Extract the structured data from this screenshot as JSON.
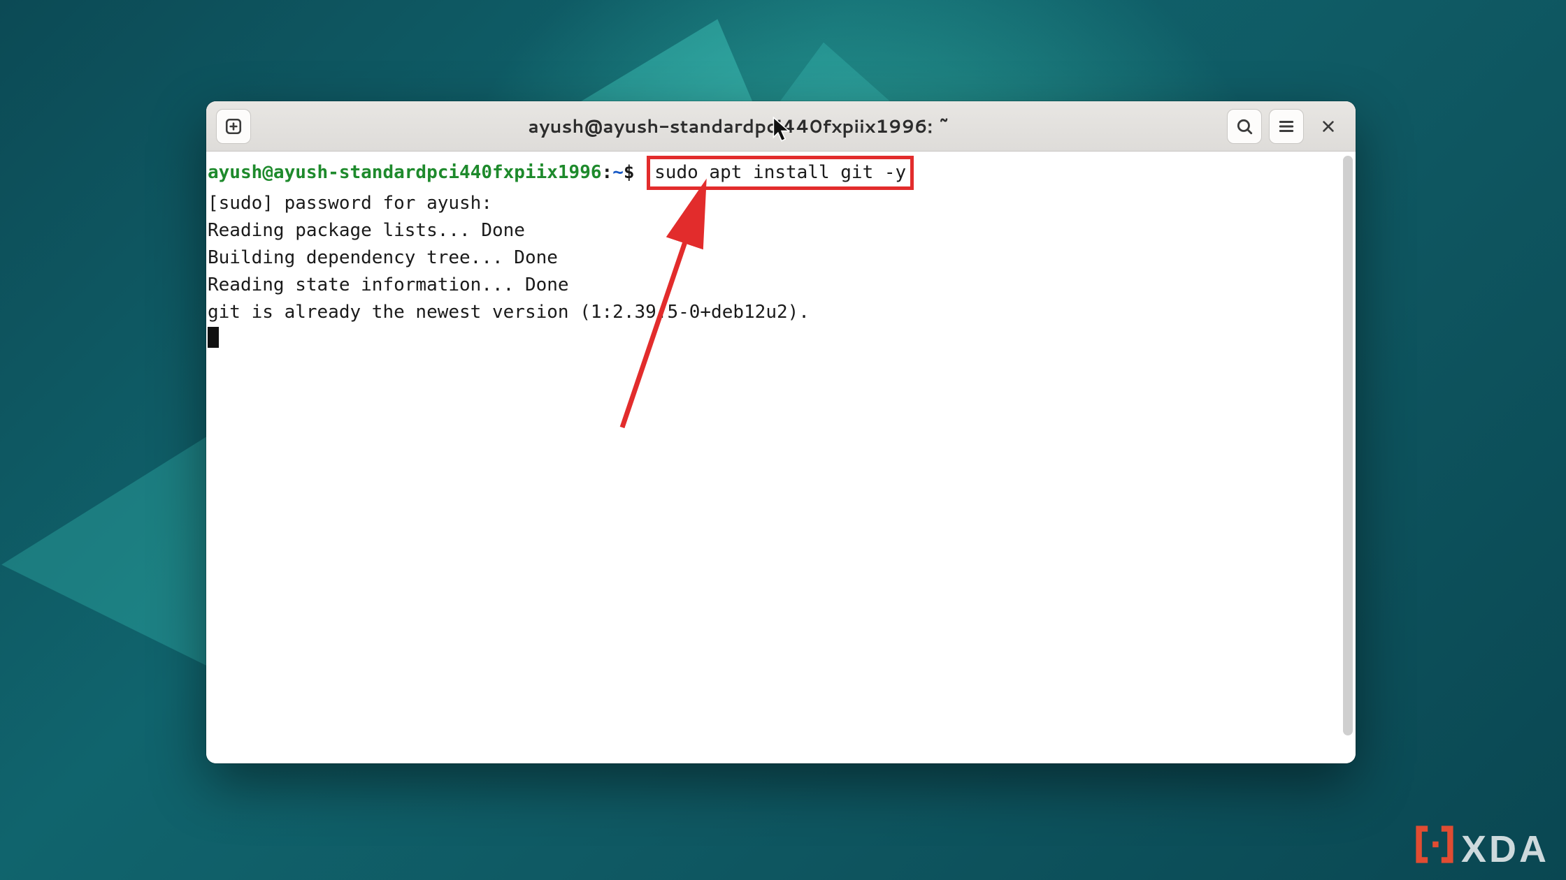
{
  "window": {
    "title": "ayush@ayush-standardpci440fxpiix1996: ~"
  },
  "toolbar": {
    "new_tab_button": "New tab",
    "search_button": "Search",
    "menu_button": "Menu",
    "close_button": "Close"
  },
  "prompt": {
    "user_host": "ayush@ayush-standardpci440fxpiix1996",
    "separator1": ":",
    "path": "~",
    "separator2": "$"
  },
  "command": "sudo apt install git -y",
  "output_lines": [
    "[sudo] password for ayush:",
    "Reading package lists... Done",
    "Building dependency tree... Done",
    "Reading state information... Done",
    "git is already the newest version (1:2.39.5-0+deb12u2)."
  ],
  "annotation": {
    "highlight_target": "command",
    "arrow_color": "#e22c2c"
  },
  "watermark": {
    "text": "XDA"
  }
}
